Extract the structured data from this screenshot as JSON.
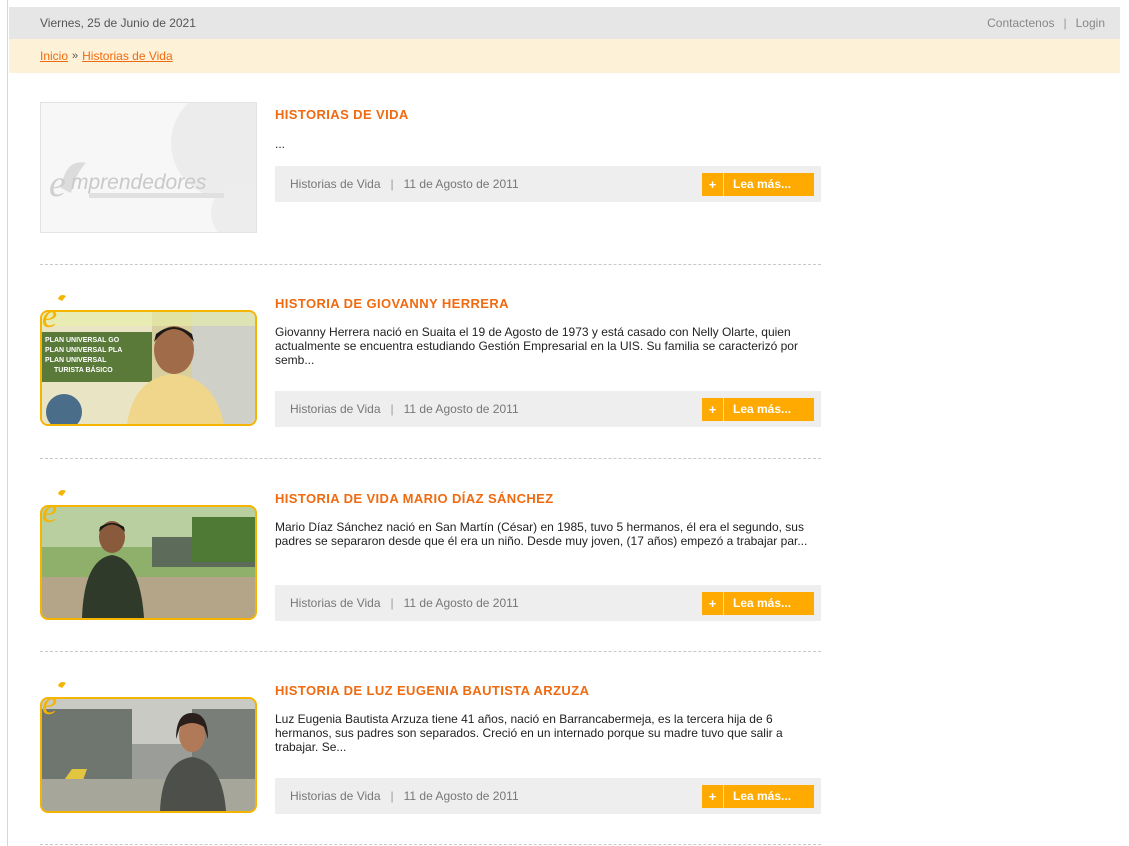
{
  "header": {
    "date": "Viernes, 25 de Junio de 2021",
    "contact_label": "Contactenos",
    "separator": "|",
    "login_label": "Login"
  },
  "breadcrumb": {
    "home_label": "Inicio",
    "arrow": "»",
    "current_label": "Historias de Vida"
  },
  "articles": [
    {
      "title": "HISTORIAS DE VIDA",
      "summary": "...",
      "category": "Historias de Vida",
      "date": "11 de Agosto de 2011",
      "read_more": "Lea más...",
      "thumbnail_text": "mprendedores"
    },
    {
      "title": "HISTORIA DE GIOVANNY HERRERA",
      "summary": "Giovanny Herrera nació en Suaita el 19 de Agosto de 1973 y está casado con Nelly Olarte, quien actualmente se encuentra estudiando Gestión Empresarial en la UIS. Su familia se caracterizó por semb...",
      "category": "Historias de Vida",
      "date": "11 de Agosto de 2011",
      "read_more": "Lea más...",
      "thumbnail_lines": [
        "PLAN UNIVERSAL GO",
        "PLAN UNIVERSAL PLA",
        "PLAN UNIVERSAL",
        "TURISTA BÁSICO"
      ]
    },
    {
      "title": "HISTORIA DE VIDA MARIO DÍAZ SÁNCHEZ",
      "summary": "Mario Díaz Sánchez nació en San Martín (César) en 1985, tuvo 5 hermanos, él era el segundo, sus padres se separaron desde que él era un niño. Desde muy joven, (17 años) empezó a trabajar par...",
      "category": "Historias de Vida",
      "date": "11 de Agosto de 2011",
      "read_more": "Lea más..."
    },
    {
      "title": "HISTORIA DE LUZ EUGENIA BAUTISTA ARZUZA",
      "summary": "Luz Eugenia Bautista Arzuza tiene 41 años, nació en Barrancabermeja, es la tercera hija de 6 hermanos, sus padres son separados. Creció en un internado porque su madre tuvo que salir a trabajar. Se...",
      "category": "Historias de Vida",
      "date": "11 de Agosto de 2011",
      "read_more": "Lea más..."
    }
  ],
  "colors": {
    "accent": "#f06a10",
    "button": "#ffaa00",
    "topbar": "#e6e6e6",
    "breadcrumb_bg": "#fdf1d8",
    "meta_bg": "#eeeeee"
  }
}
